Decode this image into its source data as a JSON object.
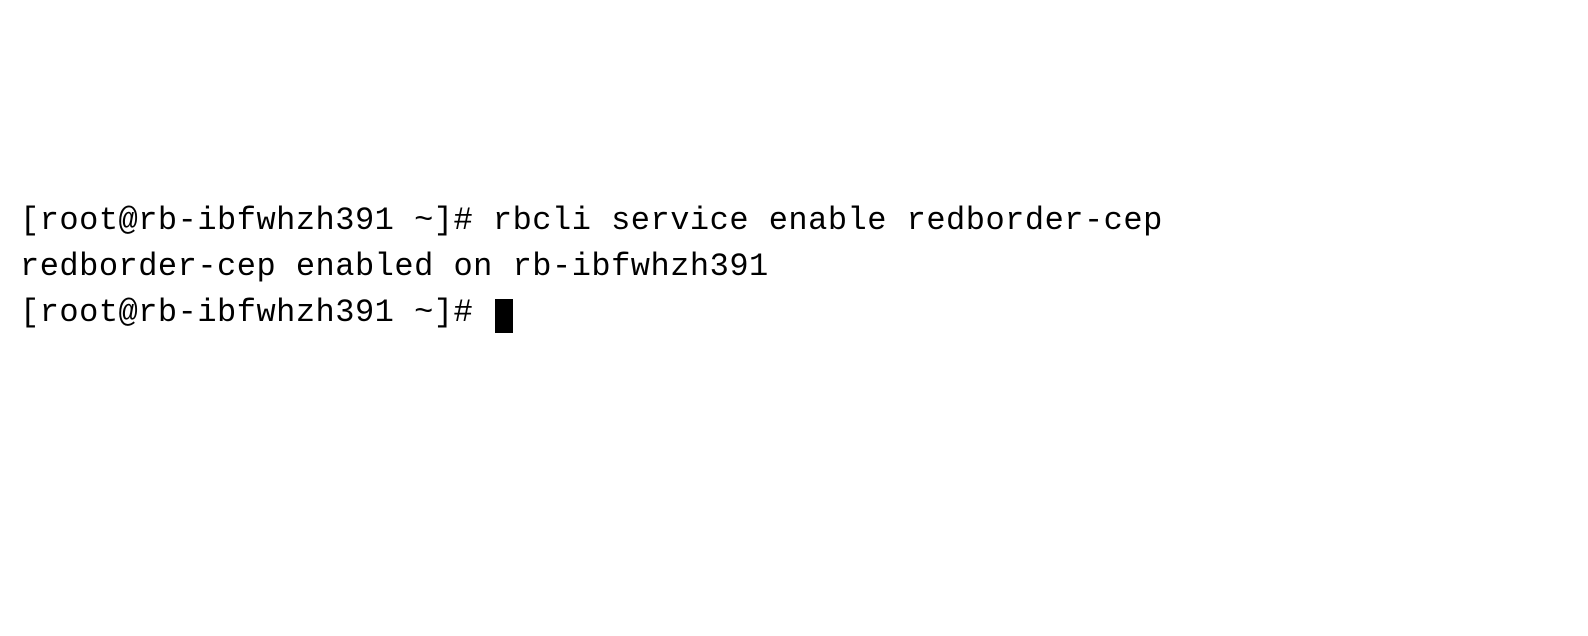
{
  "terminal": {
    "lines": [
      {
        "prompt": "[root@rb-ibfwhzh391 ~]# ",
        "command": "rbcli service enable redborder-cep"
      },
      {
        "output": "redborder-cep enabled on rb-ibfwhzh391"
      },
      {
        "prompt": "[root@rb-ibfwhzh391 ~]# ",
        "command": ""
      }
    ]
  }
}
